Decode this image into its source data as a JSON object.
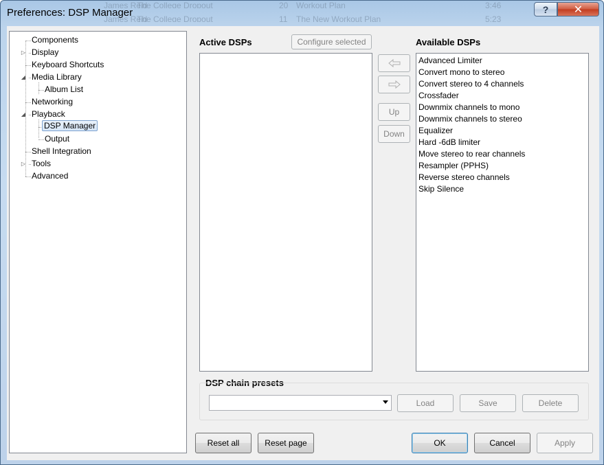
{
  "window": {
    "title": "Preferences: DSP Manager",
    "help_label": "?",
    "close_label": "✕",
    "background_rows": [
      {
        "col1": "James Reid",
        "col2": "The College Dropout",
        "col3": "20",
        "col4": "Workout Plan",
        "col5": "3:46"
      },
      {
        "col1": "James Reid",
        "col2": "The College Dropout",
        "col3": "11",
        "col4": "The New Workout Plan",
        "col5": "5:23"
      }
    ]
  },
  "tree": {
    "items": [
      {
        "label": "Components",
        "level": 0,
        "expander": "none"
      },
      {
        "label": "Display",
        "level": 0,
        "expander": "collapsed"
      },
      {
        "label": "Keyboard Shortcuts",
        "level": 0,
        "expander": "none"
      },
      {
        "label": "Media Library",
        "level": 0,
        "expander": "expanded"
      },
      {
        "label": "Album List",
        "level": 1,
        "expander": "none"
      },
      {
        "label": "Networking",
        "level": 0,
        "expander": "none"
      },
      {
        "label": "Playback",
        "level": 0,
        "expander": "expanded"
      },
      {
        "label": "DSP Manager",
        "level": 1,
        "expander": "none",
        "selected": true
      },
      {
        "label": "Output",
        "level": 1,
        "expander": "none"
      },
      {
        "label": "Shell Integration",
        "level": 0,
        "expander": "none"
      },
      {
        "label": "Tools",
        "level": 0,
        "expander": "collapsed"
      },
      {
        "label": "Advanced",
        "level": 0,
        "expander": "none"
      }
    ]
  },
  "dsp": {
    "active_heading": "Active DSPs",
    "configure_label": "Configure selected",
    "available_heading": "Available DSPs",
    "active_items": [],
    "available_items": [
      "Advanced Limiter",
      "Convert mono to stereo",
      "Convert stereo to 4 channels",
      "Crossfader",
      "Downmix channels to mono",
      "Downmix channels to stereo",
      "Equalizer",
      "Hard -6dB limiter",
      "Move stereo to rear channels",
      "Resampler (PPHS)",
      "Reverse stereo channels",
      "Skip Silence"
    ],
    "add_icon": "arrow-left-icon",
    "remove_icon": "arrow-right-icon",
    "up_label": "Up",
    "down_label": "Down"
  },
  "presets": {
    "heading": "DSP chain presets",
    "selected_value": "",
    "load_label": "Load",
    "save_label": "Save",
    "delete_label": "Delete"
  },
  "footer": {
    "reset_all_label": "Reset all",
    "reset_page_label": "Reset page",
    "ok_label": "OK",
    "cancel_label": "Cancel",
    "apply_label": "Apply"
  },
  "colors": {
    "selection_border": "#7da2ce",
    "default_button_border": "#3c7fb1",
    "close_button": "#c23b1f"
  }
}
